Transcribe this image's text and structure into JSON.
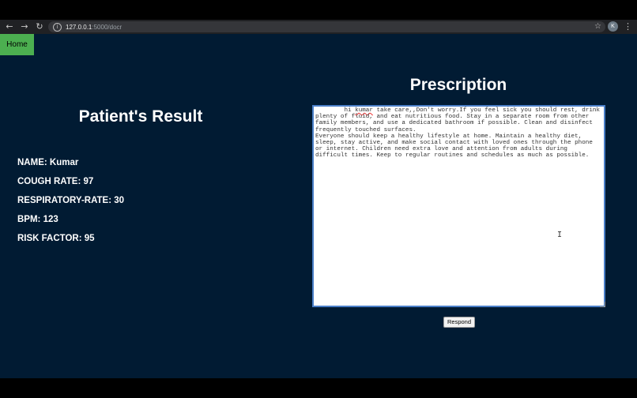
{
  "browser": {
    "url_host": "127.0.0.1",
    "url_rest": ":5000/docr",
    "profile_initial": "K"
  },
  "nav": {
    "home_label": "Home"
  },
  "result": {
    "title": "Patient's Result",
    "items": [
      "NAME: Kumar",
      "COUGH RATE: 97",
      "RESPIRATORY-RATE: 30",
      "BPM: 123",
      "RISK FACTOR: 95"
    ]
  },
  "prescription": {
    "title": "Prescription",
    "text_lead": "        hi ",
    "text_name": "kumar",
    "text_body": " take care,,Don't worry.If you feel sick you should rest, drink plenty of fluid, and eat nutritious food. Stay in a separate room from other family members, and use a dedicated bathroom if possible. Clean and disinfect frequently touched surfaces.\nEveryone should keep a healthy lifestyle at home. Maintain a healthy diet, sleep, stay active, and make social contact with loved ones through the phone or internet. Children need extra love and attention from adults during difficult times. Keep to regular routines and schedules as much as possible.",
    "respond_label": "Respond"
  }
}
